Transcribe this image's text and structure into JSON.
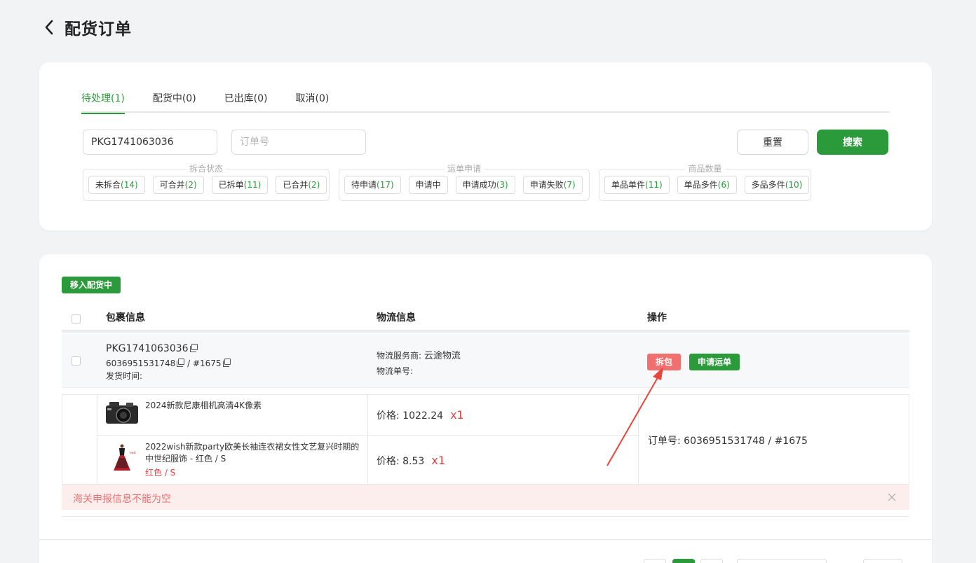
{
  "header": {
    "title": "配货订单"
  },
  "tabs": [
    {
      "label": "待处理(1)"
    },
    {
      "label": "配货中(0)"
    },
    {
      "label": "已出库(0)"
    },
    {
      "label": "取消(0)"
    }
  ],
  "search": {
    "package_value": "PKG1741063036",
    "order_placeholder": "订单号",
    "reset_label": "重置",
    "search_label": "搜索"
  },
  "filters": {
    "merge": {
      "title": "拆合状态",
      "chips": [
        {
          "label": "未拆合",
          "count": "(14)"
        },
        {
          "label": "可合并",
          "count": "(2)"
        },
        {
          "label": "已拆单",
          "count": "(11)"
        },
        {
          "label": "已合并",
          "count": "(2)"
        }
      ]
    },
    "waybill": {
      "title": "运单申请",
      "chips": [
        {
          "label": "待申请",
          "count": "(17)"
        },
        {
          "label": "申请中",
          "count": ""
        },
        {
          "label": "申请成功",
          "count": "(3)"
        },
        {
          "label": "申请失败",
          "count": "(7)"
        }
      ]
    },
    "quantity": {
      "title": "商品数量",
      "chips": [
        {
          "label": "单品单件",
          "count": "(11)"
        },
        {
          "label": "单品多件",
          "count": "(6)"
        },
        {
          "label": "多品多件",
          "count": "(10)"
        }
      ]
    }
  },
  "list": {
    "move_button": "移入配货中",
    "columns": {
      "package": "包裹信息",
      "logistics": "物流信息",
      "actions": "操作"
    },
    "package": {
      "id": "PKG1741063036",
      "order_ref": "6036951531748",
      "order_sep": " / #1675",
      "ship_time_label": "发货时间:",
      "carrier_label": "物流服务商: ",
      "carrier_value": "云途物流",
      "tracking_label": "物流单号:",
      "split_label": "拆包",
      "apply_label": "申请运单"
    },
    "items": [
      {
        "name": "2024新款尼康相机高清4K像素",
        "variant": "",
        "price": "价格: 1022.24",
        "qty": "x1"
      },
      {
        "name": "2022wish新款party欧美长袖连衣裙女性文艺复兴时期的中世纪服饰 - 红色 / S",
        "variant": "红色 / S",
        "price": "价格: 8.53",
        "qty": "x1"
      }
    ],
    "order_no": "订单号: 6036951531748 / #1675",
    "alert": "海关申报信息不能为空"
  },
  "colors": {
    "accent": "#2b9a3a",
    "danger": "#f07070",
    "alert_bg": "#fdeeee",
    "annotation_arrow": "#e8453c"
  },
  "icons": {
    "back": "chevron-left-icon",
    "copy": "copy-icon",
    "close": "close-icon"
  }
}
